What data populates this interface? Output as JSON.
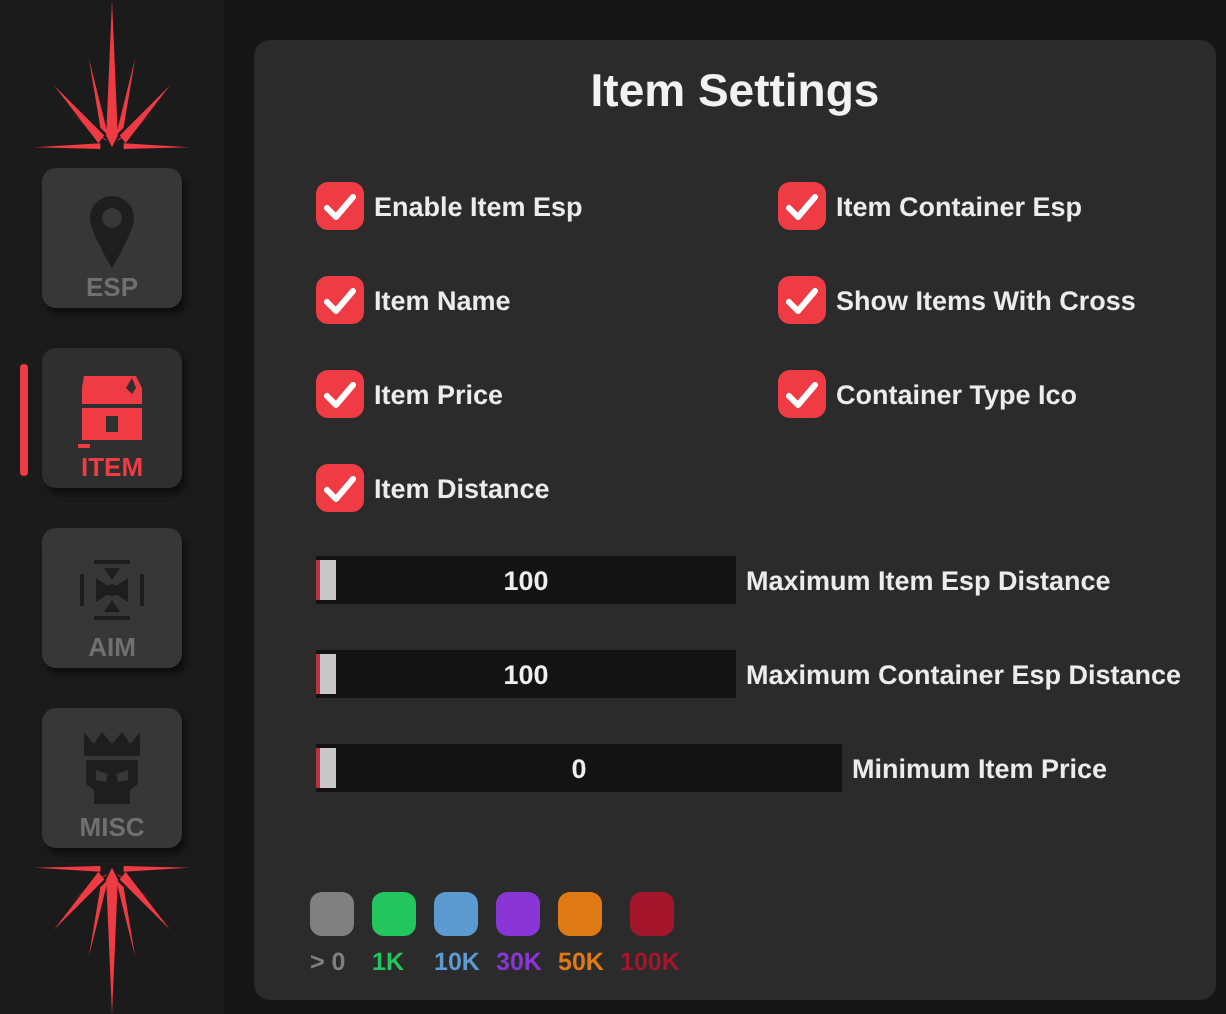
{
  "sidebar": {
    "tabs": [
      {
        "label": "ESP",
        "kind": "pin",
        "selected": false
      },
      {
        "label": "ITEM",
        "kind": "chest",
        "selected": true
      },
      {
        "label": "AIM",
        "kind": "crosshair",
        "selected": false
      },
      {
        "label": "MISC",
        "kind": "skull",
        "selected": false
      }
    ]
  },
  "panel": {
    "title": "Item Settings",
    "checkboxes": [
      {
        "label": "Enable Item Esp",
        "checked": true
      },
      {
        "label": "Item Container Esp",
        "checked": true
      },
      {
        "label": "Item Name",
        "checked": true
      },
      {
        "label": "Show Items With Cross",
        "checked": true
      },
      {
        "label": "Item Price",
        "checked": true
      },
      {
        "label": "Container Type Ico",
        "checked": true
      },
      {
        "label": "Item Distance",
        "checked": true
      }
    ],
    "sliders": [
      {
        "value": "100",
        "label": "Maximum Item Esp Distance",
        "level": 0
      },
      {
        "value": "100",
        "label": "Maximum Container Esp Distance",
        "level": 0
      },
      {
        "value": "0",
        "label": "Minimum Item Price",
        "level": 0
      }
    ],
    "price_colors": [
      {
        "label": "> 0",
        "color": "#808080"
      },
      {
        "label": "1K",
        "color": "#22c55e"
      },
      {
        "label": "10K",
        "color": "#5b9bd1"
      },
      {
        "label": "30K",
        "color": "#8a35d6"
      },
      {
        "label": "50K",
        "color": "#e07a14"
      },
      {
        "label": "100K",
        "color": "#a3162b"
      }
    ]
  }
}
